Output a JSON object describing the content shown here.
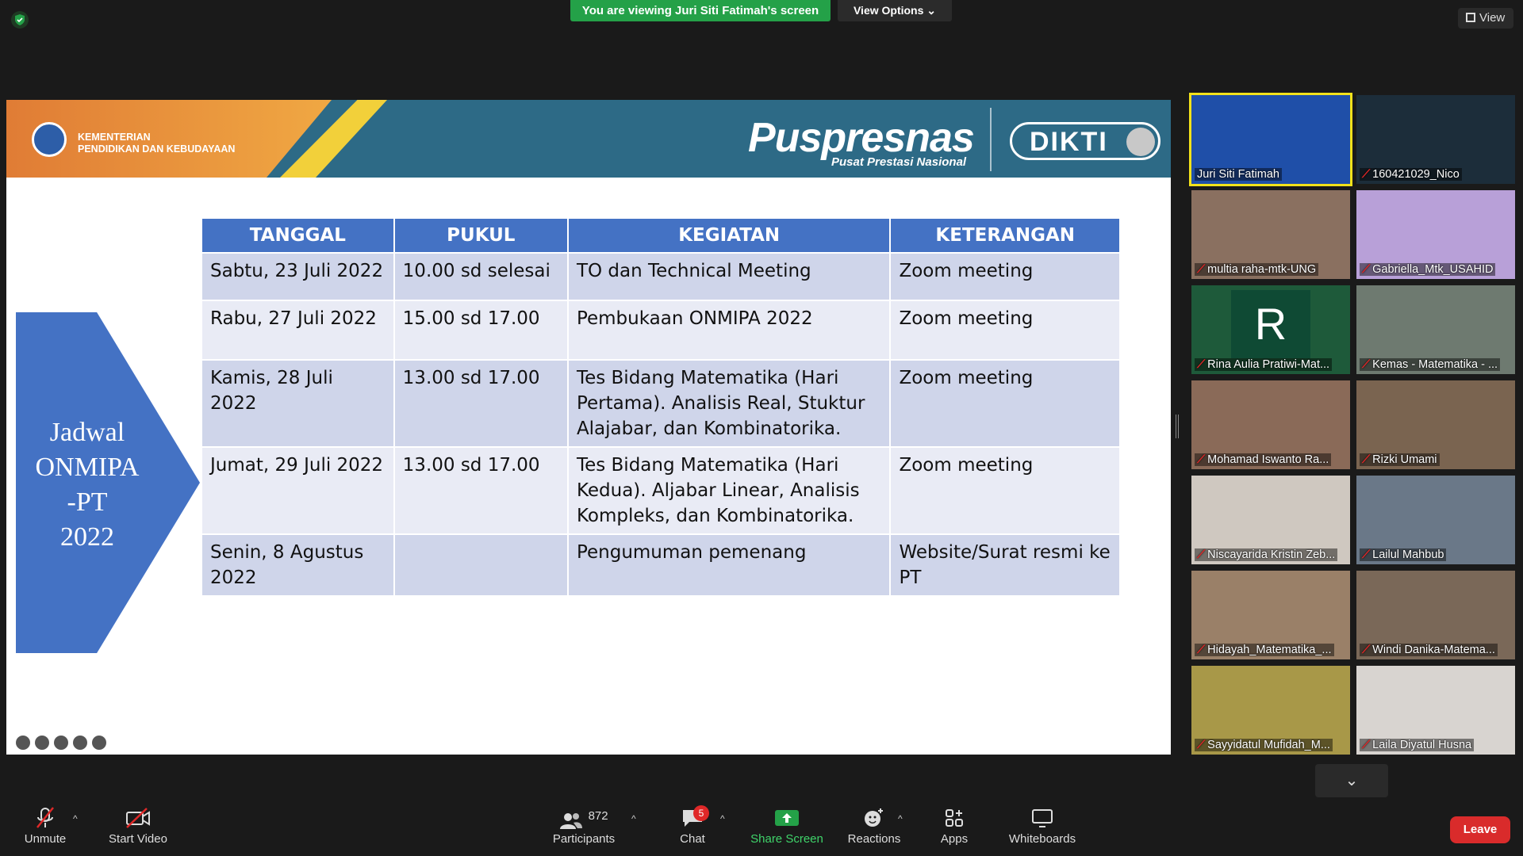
{
  "top": {
    "viewing_banner": "You are viewing Juri Siti Fatimah's screen",
    "view_options": "View Options",
    "view_button": "View"
  },
  "slide": {
    "ministry_line1": "KEMENTERIAN",
    "ministry_line2": "PENDIDIKAN DAN KEBUDAYAAN",
    "brand": "Puspresnas",
    "brand_sub": "Pusat Prestasi Nasional",
    "dikti": "DIKTI",
    "arrow_title_l1": "Jadwal",
    "arrow_title_l2": "ONMIPA",
    "arrow_title_l3": "-PT",
    "arrow_title_l4": "2022",
    "table": {
      "headers": [
        "TANGGAL",
        "PUKUL",
        "KEGIATAN",
        "KETERANGAN"
      ],
      "rows": [
        [
          "Sabtu, 23 Juli 2022",
          "10.00 sd selesai",
          "TO dan Technical Meeting",
          "Zoom meeting"
        ],
        [
          "Rabu, 27 Juli 2022",
          "15.00 sd 17.00",
          "Pembukaan ONMIPA 2022",
          "Zoom meeting"
        ],
        [
          "Kamis, 28 Juli 2022",
          "13.00 sd 17.00",
          "Tes Bidang Matematika (Hari Pertama). Analisis Real, Stuktur Alajabar, dan Kombinatorika.",
          "Zoom meeting"
        ],
        [
          "Jumat, 29 Juli 2022",
          "13.00 sd 17.00",
          "Tes Bidang Matematika (Hari Kedua). Aljabar Linear, Analisis Kompleks, dan Kombinatorika.",
          "Zoom meeting"
        ],
        [
          "Senin, 8 Agustus 2022",
          "",
          "Pengumuman pemenang",
          "Website/Surat resmi ke PT"
        ]
      ]
    }
  },
  "gallery": [
    {
      "name": "Juri Siti Fatimah",
      "active": true,
      "bg": "#1f4fa8"
    },
    {
      "name": "160421029_Nico",
      "active": false,
      "bg": "#1c2d3a"
    },
    {
      "name": "multia raha-mtk-UNG",
      "active": false,
      "bg": "#8a7060"
    },
    {
      "name": "Gabriella_Mtk_USAHID",
      "active": false,
      "bg": "#b8a0d8"
    },
    {
      "name": "Rina Aulia Pratiwi-Mat...",
      "active": false,
      "bg": "#1e5a3a"
    },
    {
      "name": "Kemas - Matematika - ...",
      "active": false,
      "bg": "#6e7a70"
    },
    {
      "name": "Mohamad Iswanto Ra...",
      "active": false,
      "bg": "#8a6a58"
    },
    {
      "name": "Rizki Umami",
      "active": false,
      "bg": "#7a6450"
    },
    {
      "name": "Niscayarida Kristin Zeb...",
      "active": false,
      "bg": "#cfc8c0"
    },
    {
      "name": "Lailul Mahbub",
      "active": false,
      "bg": "#6a7888"
    },
    {
      "name": "Hidayah_Matematika_...",
      "active": false,
      "bg": "#9a8068"
    },
    {
      "name": "Windi Danika-Matema...",
      "active": false,
      "bg": "#7a6858"
    },
    {
      "name": "Sayyidatul Mufidah_M...",
      "active": false,
      "bg": "#a89848"
    },
    {
      "name": "Laila Diyatul Husna",
      "active": false,
      "bg": "#d8d4d0"
    }
  ],
  "gallery_first_initial": "R",
  "toolbar": {
    "unmute": "Unmute",
    "start_video": "Start Video",
    "participants": "Participants",
    "participants_count": "872",
    "chat": "Chat",
    "chat_badge": "5",
    "share_screen": "Share Screen",
    "reactions": "Reactions",
    "apps": "Apps",
    "whiteboards": "Whiteboards",
    "leave": "Leave"
  }
}
